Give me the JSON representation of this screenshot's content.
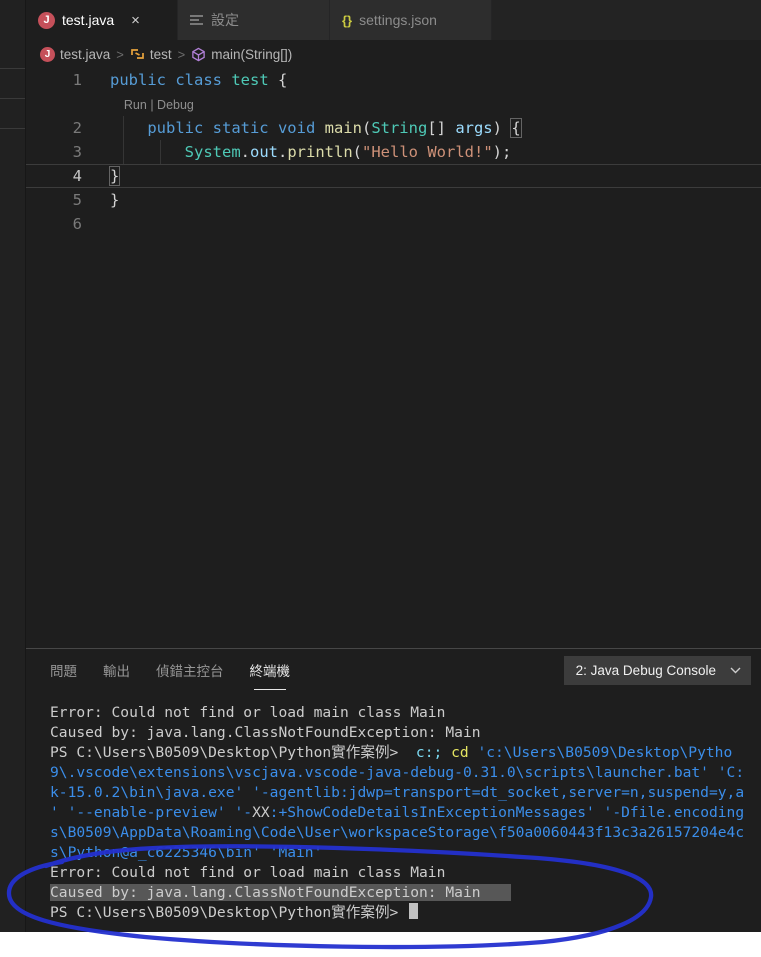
{
  "tab_bar": {
    "tabs": [
      {
        "label": "test.java",
        "icon": "java-icon",
        "close": "×",
        "active": true
      },
      {
        "label": "設定",
        "icon": "settings-icon",
        "active": false
      },
      {
        "label": "settings.json",
        "icon": "braces-icon",
        "braces": "{}",
        "active": false
      }
    ]
  },
  "breadcrumb": {
    "separator": ">",
    "items": [
      {
        "label": "test.java",
        "icon": "java-icon"
      },
      {
        "label": "test",
        "icon": "class-icon"
      },
      {
        "label": "main(String[])",
        "icon": "method-icon"
      }
    ]
  },
  "editor": {
    "codelens": {
      "run_label": "Run",
      "separator": "|",
      "debug_label": "Debug"
    },
    "code_lines": [
      {
        "num": "1",
        "segs": [
          [
            "kw",
            "public class "
          ],
          [
            "cls",
            "test"
          ],
          [
            "pl",
            " {"
          ]
        ]
      },
      {
        "codelens": true
      },
      {
        "num": "2",
        "segs": [
          [
            "pl",
            "    "
          ],
          [
            "kw",
            "public static void "
          ],
          [
            "fn",
            "main"
          ],
          [
            "pl",
            "("
          ],
          [
            "cls",
            "String"
          ],
          [
            "pl",
            "[] "
          ],
          [
            "prm",
            "args"
          ],
          [
            "pl",
            ") "
          ],
          [
            "brk",
            "{"
          ]
        ],
        "guides": [
          1
        ]
      },
      {
        "num": "3",
        "segs": [
          [
            "pl",
            "        "
          ],
          [
            "cls",
            "System"
          ],
          [
            "pl",
            "."
          ],
          [
            "prm",
            "out"
          ],
          [
            "pl",
            "."
          ],
          [
            "fn",
            "println"
          ],
          [
            "pl",
            "("
          ],
          [
            "str",
            "\"Hello World!\""
          ],
          [
            "pl",
            ");"
          ]
        ],
        "guides": [
          1,
          2
        ]
      },
      {
        "num": "4",
        "current": true,
        "segs": [
          [
            "brk",
            "}"
          ]
        ]
      },
      {
        "num": "5",
        "segs": [
          [
            "pl",
            "}"
          ]
        ]
      },
      {
        "num": "6",
        "segs": []
      }
    ]
  },
  "panel": {
    "tabs": [
      {
        "label": "問題",
        "active": false
      },
      {
        "label": "輸出",
        "active": false
      },
      {
        "label": "偵錯主控台",
        "active": false
      },
      {
        "label": "終端機",
        "active": true
      }
    ],
    "dropdown_value": "2: Java Debug Console"
  },
  "terminal": {
    "lines": [
      {
        "segs": [
          [
            "fg",
            "Error: Could not find or load main class Main"
          ]
        ]
      },
      {
        "segs": [
          [
            "fg",
            "Caused by: java.lang.ClassNotFoundException: Main"
          ]
        ]
      },
      {
        "segs": [
          [
            "fg",
            "PS C:\\Users\\B0509\\Desktop\\Python實作案例>  "
          ],
          [
            "cyan",
            "c:;"
          ],
          [
            "fg",
            " "
          ],
          [
            "yel",
            "cd"
          ],
          [
            "fg",
            " "
          ],
          [
            "blue",
            "'c:\\Users\\B0509\\Desktop\\Pytho"
          ]
        ]
      },
      {
        "segs": [
          [
            "blue",
            "9\\.vscode\\extensions\\vscjava.vscode-java-debug-0.31.0\\scripts\\launcher.bat' 'C:"
          ]
        ]
      },
      {
        "segs": [
          [
            "blue",
            "k-15.0.2\\bin\\java.exe' '-agentlib:jdwp=transport=dt_socket,server=n,suspend=y,a"
          ]
        ]
      },
      {
        "segs": [
          [
            "blue",
            "' '--enable-preview' '-"
          ],
          [
            "fg",
            "XX"
          ],
          [
            "blue",
            ":+ShowCodeDetailsInExceptionMessages' '-Dfile.encoding"
          ]
        ]
      },
      {
        "segs": [
          [
            "blue",
            "s\\B0509\\AppData\\Roaming\\Code\\User\\workspaceStorage\\f50a0060443f13c3a26157204e4c"
          ]
        ]
      },
      {
        "segs": [
          [
            "blue",
            "s\\Python@a_c6225346\\bin' 'Main'"
          ]
        ]
      },
      {
        "segs": [
          [
            "fg",
            "Error: Could not find or load main class Main"
          ]
        ]
      },
      {
        "selected": true,
        "segs": [
          [
            "fg",
            "Caused by: java.lang.ClassNotFoundException: Main"
          ]
        ]
      },
      {
        "segs": [
          [
            "fg",
            "PS C:\\Users\\B0509\\Desktop\\Python實作案例> "
          ]
        ],
        "cursor": true
      }
    ]
  },
  "colors": {
    "annotation_blue": "#2430cf",
    "terminal_blue": "#3b8eea",
    "java_icon_red": "#c5505a",
    "class_icon_orange": "#e8a33d",
    "method_icon_purple": "#b180d7",
    "braces_yellow": "#cbcb41"
  }
}
